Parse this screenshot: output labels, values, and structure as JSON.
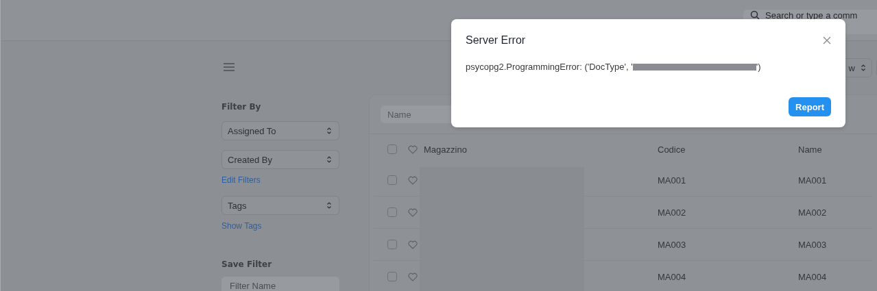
{
  "navbar": {
    "search": {
      "placeholder": "Search or type a comm"
    }
  },
  "toolbar": {
    "view_button": "w"
  },
  "sidebar": {
    "heading": "Filter By",
    "filters": [
      {
        "kind": "select",
        "label": "Assigned To"
      },
      {
        "kind": "select",
        "label": "Created By"
      },
      {
        "kind": "link",
        "label": "Edit Filters"
      },
      {
        "kind": "select",
        "label": "Tags"
      },
      {
        "kind": "link",
        "label": "Show Tags"
      }
    ],
    "save_filter": {
      "heading": "Save Filter",
      "placeholder": "Filter Name"
    }
  },
  "list": {
    "filter_placeholder": "Name",
    "columns": [
      "Magazzino",
      "Codice",
      "Name"
    ],
    "header_checked": false,
    "rows": [
      {
        "checked": false,
        "liked": false,
        "codice": "MA001",
        "name": "MA001"
      },
      {
        "checked": false,
        "liked": false,
        "codice": "MA002",
        "name": "MA002"
      },
      {
        "checked": false,
        "liked": false,
        "codice": "MA003",
        "name": "MA003"
      },
      {
        "checked": false,
        "liked": false,
        "codice": "MA004",
        "name": "MA004"
      }
    ]
  },
  "dialog": {
    "title": "Server Error",
    "message_start": "psycopg2.ProgrammingError: ('DocType', '",
    "message_end": "')",
    "button": "Report"
  }
}
